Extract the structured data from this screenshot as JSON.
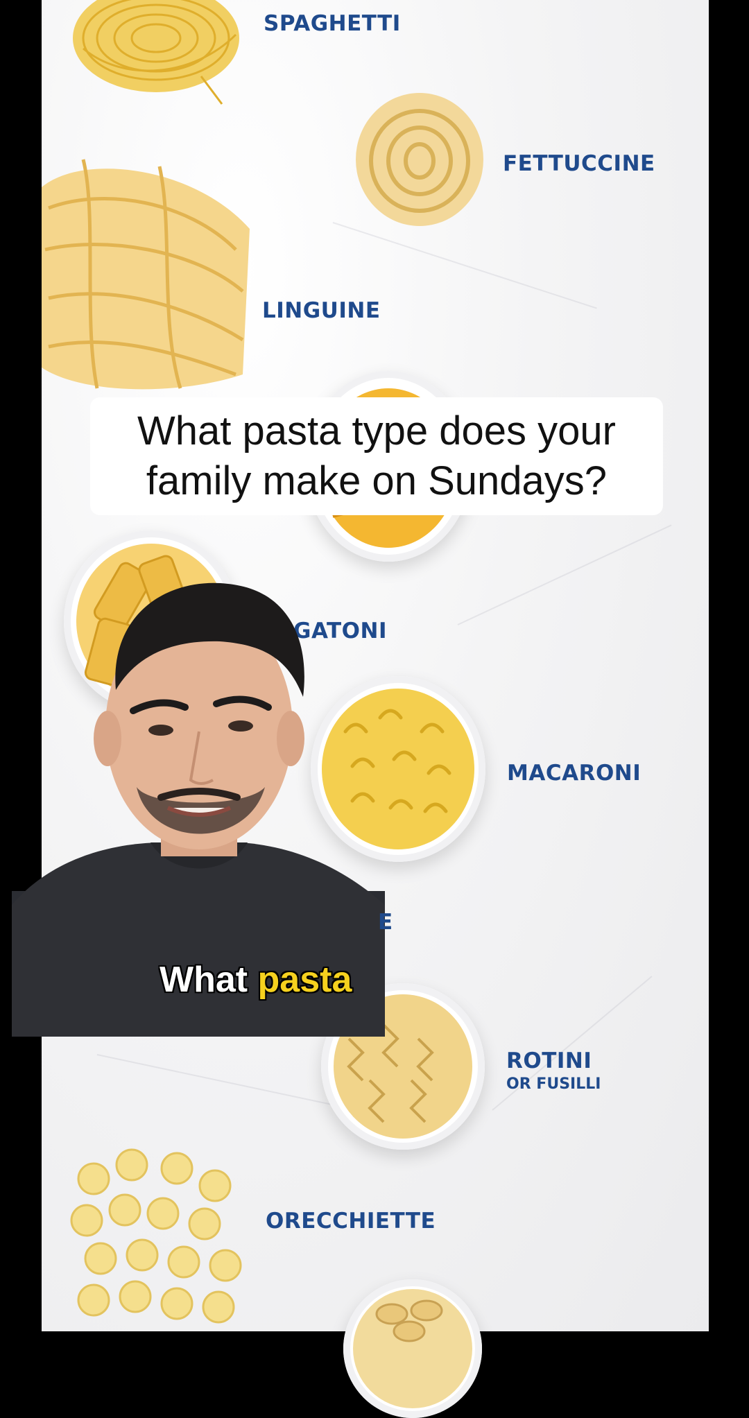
{
  "pasta_labels": {
    "spaghetti": "SPAGHETTI",
    "fettuccine": "FETTUCCINE",
    "linguine": "LINGUINE",
    "rigatoni": "GATONI",
    "macaroni": "MACARONI",
    "penne_partial": "E",
    "rotini": "ROTINI",
    "rotini_sub": "OR FUSILLI",
    "orecchiette": "ORECCHIETTE"
  },
  "question": {
    "line1": "What pasta type does your",
    "line2": "family make on Sundays?"
  },
  "caption": {
    "word1": "What",
    "word2": "pasta"
  },
  "colors": {
    "label_blue": "#1f4a8c",
    "caption_highlight": "#f6d11e",
    "background": "#f4f4f5"
  }
}
